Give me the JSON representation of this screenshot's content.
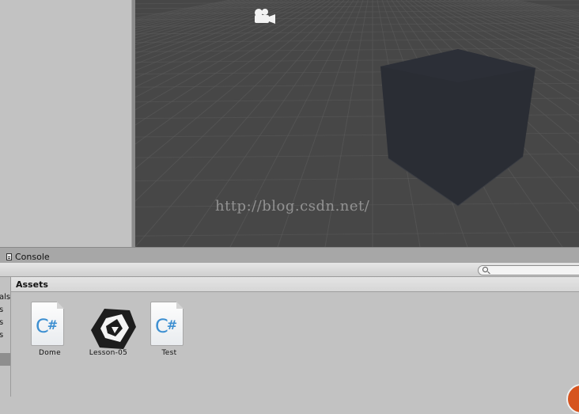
{
  "scene": {
    "background": "#474747",
    "cube_color": "#2b2e35",
    "grid_color": "#5a5a5a",
    "camera_icon": "camera-gizmo-icon"
  },
  "watermark": "http://blog.csdn.net/",
  "console_tab": {
    "label": "Console",
    "icon": "console-icon"
  },
  "toolbar": {
    "search_icon": "search-icon",
    "search_placeholder": ""
  },
  "folder_tree": {
    "items": [
      "als",
      "s",
      "s",
      "s"
    ]
  },
  "assets": {
    "title": "Assets",
    "items": [
      {
        "name": "Dome",
        "kind": "csharp-script",
        "icon_text": "C#"
      },
      {
        "name": "Lesson-05",
        "kind": "unity-scene",
        "icon_text": ""
      },
      {
        "name": "Test",
        "kind": "csharp-script",
        "icon_text": "C#"
      }
    ]
  },
  "colors": {
    "panel": "#c2c2c2",
    "header": "#dcdcdc",
    "csharp_blue": "#3d8fd1",
    "accent_orange": "#d6541f"
  }
}
